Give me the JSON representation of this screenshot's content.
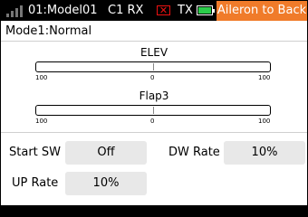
{
  "status_bar": {
    "model": "01:Model01",
    "rx_label": "C1 RX",
    "rx_error_symbol": "✕",
    "tx_label": "TX",
    "alert": "Aileron to Back",
    "alert_color": "#f07b2a"
  },
  "mode": "Mode1:Normal",
  "bars": [
    {
      "title": "ELEV",
      "left": "100",
      "center": "0",
      "right": "100",
      "value": 0
    },
    {
      "title": "Flap3",
      "left": "100",
      "center": "0",
      "right": "100",
      "value": 0
    }
  ],
  "settings": {
    "start_sw_label": "Start SW",
    "start_sw_value": "Off",
    "dw_rate_label": "DW Rate",
    "dw_rate_value": "10%",
    "up_rate_label": "UP Rate",
    "up_rate_value": "10%"
  }
}
